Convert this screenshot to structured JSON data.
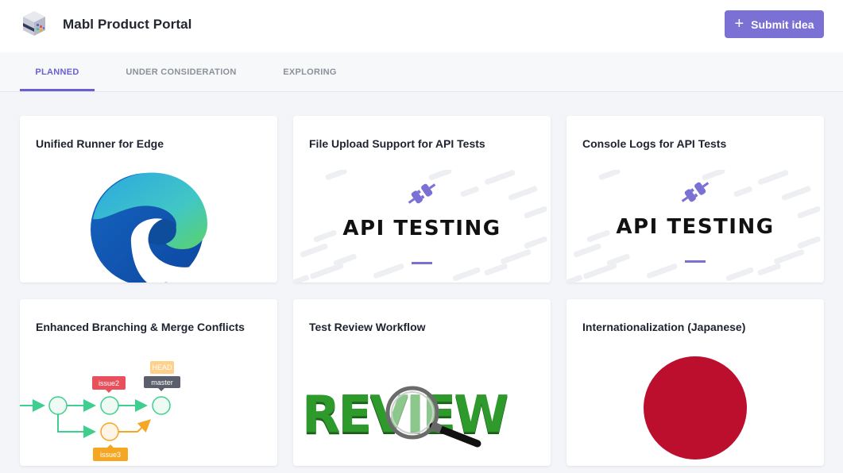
{
  "header": {
    "logo_icon": "mabl-logo-icon",
    "title": "Mabl Product Portal",
    "submit_button": {
      "icon": "plus-icon",
      "label": "Submit idea"
    }
  },
  "tabs": [
    {
      "label": "PLANNED",
      "active": true
    },
    {
      "label": "UNDER CONSIDERATION",
      "active": false
    },
    {
      "label": "EXPLORING",
      "active": false
    }
  ],
  "cards": [
    {
      "title": "Unified Runner for Edge",
      "image": "edge-browser-logo"
    },
    {
      "title": "File Upload Support for API Tests",
      "image": "api-testing-banner",
      "image_text": "API TESTING"
    },
    {
      "title": "Console Logs for API Tests",
      "image": "api-testing-banner",
      "image_text": "API TESTING"
    },
    {
      "title": "Enhanced Branching & Merge Conflicts",
      "image": "git-branch-diagram",
      "diagram_labels": {
        "head": "HEAD",
        "master": "master",
        "issue2": "issue2",
        "issue3": "issue3"
      }
    },
    {
      "title": "Test Review Workflow",
      "image": "review-magnifier-graphic",
      "image_text": "REVIEW"
    },
    {
      "title": "Internationalization (Japanese)",
      "image": "japan-flag"
    }
  ],
  "colors": {
    "accent": "#7b70d4",
    "tab_active": "#6b5fd0",
    "branch_green": "#3ecf8e",
    "branch_orange": "#f5a623",
    "issue2_red": "#e8505b",
    "japan_red": "#bc0f2e",
    "review_green": "#2f9a2c"
  }
}
